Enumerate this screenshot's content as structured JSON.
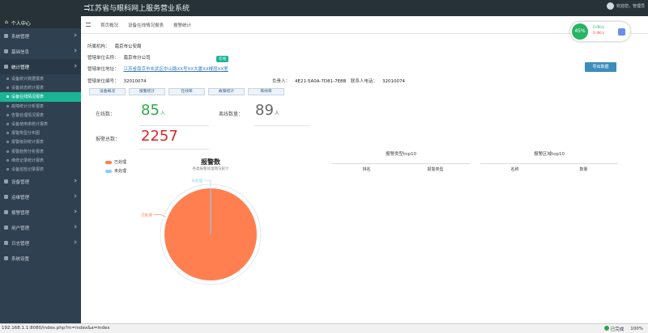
{
  "app": {
    "title": "江苏省与眼科网上服务营业系统"
  },
  "topbar": {
    "user": "欢迎您，管理员"
  },
  "sidebar": {
    "brand": "个人中心",
    "items": [
      {
        "label": "系统管理",
        "open": false
      },
      {
        "label": "基础信息",
        "open": false
      },
      {
        "label": "统计管理",
        "open": true
      }
    ],
    "subitems": [
      {
        "label": "设备统计数据报表",
        "active": false
      },
      {
        "label": "设备状态统计报表",
        "active": false
      },
      {
        "label": "设备在线情况报表",
        "active": true
      },
      {
        "label": "故障统计分析报表",
        "active": false
      },
      {
        "label": "告警处理情况报表",
        "active": false
      },
      {
        "label": "设备使用率统计报表",
        "active": false
      },
      {
        "label": "报警类型分布图",
        "active": false
      },
      {
        "label": "报警级别统计报表",
        "active": false
      },
      {
        "label": "报警趋势分析报表",
        "active": false
      },
      {
        "label": "维修记录统计报表",
        "active": false
      },
      {
        "label": "设备巡检记录报表",
        "active": false
      }
    ],
    "items_bottom": [
      {
        "label": "设备管理"
      },
      {
        "label": "运维管理"
      },
      {
        "label": "报警管理"
      },
      {
        "label": "用户管理"
      },
      {
        "label": "日志管理"
      },
      {
        "label": "系统设置"
      }
    ]
  },
  "tabs": [
    "首页概况",
    "设备在线情况报表",
    "报警统计"
  ],
  "info": {
    "org_label": "所属机构：",
    "org_value": "南京市公安局",
    "unit_label": "管辖单位名称：",
    "unit_value": "南京市分公司",
    "status_badge": "在线",
    "addr_label": "管辖单位地址：",
    "addr_value": "江苏省南京市玄武区中山路XX号XX大厦XX楼层XX室",
    "code_label": "管辖单位编号：",
    "code_value": "32010074",
    "contact_label": "负责人：",
    "contact_value": "4E21-5A0A-7D81-7E8B",
    "phone_label": "联系人电话：",
    "phone_value": "32010074"
  },
  "export_button": "导出数据",
  "subtabs": [
    "设备概况",
    "报警统计",
    "在线率",
    "故障统计",
    "离线率"
  ],
  "stats": {
    "online_label": "在线数：",
    "online_value": "85",
    "online_unit": "人",
    "offline_label": "离线数量：",
    "offline_value": "89",
    "offline_unit": "人",
    "alarm_label": "报警总数：",
    "alarm_value": "2257"
  },
  "panels": {
    "left": {
      "title": "报警类型top10",
      "col1": "排名",
      "col2": "报警类型"
    },
    "right": {
      "title": "报警区域top10",
      "col1": "名称",
      "col2": "数量"
    }
  },
  "legend": [
    {
      "label": "已处理",
      "color": "#ff7f50"
    },
    {
      "label": "未处理",
      "color": "#87cefa"
    }
  ],
  "chart_data": {
    "type": "pie",
    "title": "报警数",
    "subtitle": "各类报警处理情况统计",
    "slices": [
      {
        "name": "已处理",
        "value": 2257
      },
      {
        "name": "未处理",
        "value": 0
      }
    ]
  },
  "widget": {
    "percent": "45%",
    "up": "0.0K/s",
    "down": "0.4K/s"
  },
  "statusbar": {
    "url": "192.168.1.1:8080/index.php?m=index&a=index",
    "state": "已完成",
    "zoom": "100%"
  }
}
